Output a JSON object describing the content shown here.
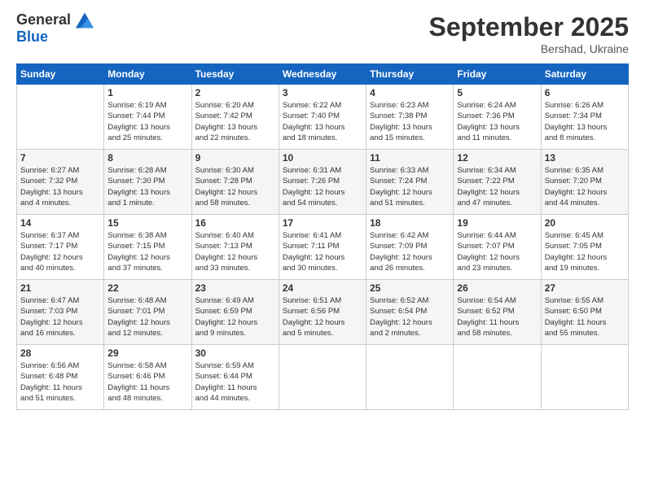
{
  "header": {
    "logo": {
      "general": "General",
      "blue": "Blue"
    },
    "title": "September 2025",
    "location": "Bershad, Ukraine"
  },
  "calendar": {
    "headers": [
      "Sunday",
      "Monday",
      "Tuesday",
      "Wednesday",
      "Thursday",
      "Friday",
      "Saturday"
    ],
    "weeks": [
      [
        {
          "day": "",
          "info": ""
        },
        {
          "day": "1",
          "info": "Sunrise: 6:19 AM\nSunset: 7:44 PM\nDaylight: 13 hours\nand 25 minutes."
        },
        {
          "day": "2",
          "info": "Sunrise: 6:20 AM\nSunset: 7:42 PM\nDaylight: 13 hours\nand 22 minutes."
        },
        {
          "day": "3",
          "info": "Sunrise: 6:22 AM\nSunset: 7:40 PM\nDaylight: 13 hours\nand 18 minutes."
        },
        {
          "day": "4",
          "info": "Sunrise: 6:23 AM\nSunset: 7:38 PM\nDaylight: 13 hours\nand 15 minutes."
        },
        {
          "day": "5",
          "info": "Sunrise: 6:24 AM\nSunset: 7:36 PM\nDaylight: 13 hours\nand 11 minutes."
        },
        {
          "day": "6",
          "info": "Sunrise: 6:26 AM\nSunset: 7:34 PM\nDaylight: 13 hours\nand 8 minutes."
        }
      ],
      [
        {
          "day": "7",
          "info": "Sunrise: 6:27 AM\nSunset: 7:32 PM\nDaylight: 13 hours\nand 4 minutes."
        },
        {
          "day": "8",
          "info": "Sunrise: 6:28 AM\nSunset: 7:30 PM\nDaylight: 13 hours\nand 1 minute."
        },
        {
          "day": "9",
          "info": "Sunrise: 6:30 AM\nSunset: 7:28 PM\nDaylight: 12 hours\nand 58 minutes."
        },
        {
          "day": "10",
          "info": "Sunrise: 6:31 AM\nSunset: 7:26 PM\nDaylight: 12 hours\nand 54 minutes."
        },
        {
          "day": "11",
          "info": "Sunrise: 6:33 AM\nSunset: 7:24 PM\nDaylight: 12 hours\nand 51 minutes."
        },
        {
          "day": "12",
          "info": "Sunrise: 6:34 AM\nSunset: 7:22 PM\nDaylight: 12 hours\nand 47 minutes."
        },
        {
          "day": "13",
          "info": "Sunrise: 6:35 AM\nSunset: 7:20 PM\nDaylight: 12 hours\nand 44 minutes."
        }
      ],
      [
        {
          "day": "14",
          "info": "Sunrise: 6:37 AM\nSunset: 7:17 PM\nDaylight: 12 hours\nand 40 minutes."
        },
        {
          "day": "15",
          "info": "Sunrise: 6:38 AM\nSunset: 7:15 PM\nDaylight: 12 hours\nand 37 minutes."
        },
        {
          "day": "16",
          "info": "Sunrise: 6:40 AM\nSunset: 7:13 PM\nDaylight: 12 hours\nand 33 minutes."
        },
        {
          "day": "17",
          "info": "Sunrise: 6:41 AM\nSunset: 7:11 PM\nDaylight: 12 hours\nand 30 minutes."
        },
        {
          "day": "18",
          "info": "Sunrise: 6:42 AM\nSunset: 7:09 PM\nDaylight: 12 hours\nand 26 minutes."
        },
        {
          "day": "19",
          "info": "Sunrise: 6:44 AM\nSunset: 7:07 PM\nDaylight: 12 hours\nand 23 minutes."
        },
        {
          "day": "20",
          "info": "Sunrise: 6:45 AM\nSunset: 7:05 PM\nDaylight: 12 hours\nand 19 minutes."
        }
      ],
      [
        {
          "day": "21",
          "info": "Sunrise: 6:47 AM\nSunset: 7:03 PM\nDaylight: 12 hours\nand 16 minutes."
        },
        {
          "day": "22",
          "info": "Sunrise: 6:48 AM\nSunset: 7:01 PM\nDaylight: 12 hours\nand 12 minutes."
        },
        {
          "day": "23",
          "info": "Sunrise: 6:49 AM\nSunset: 6:59 PM\nDaylight: 12 hours\nand 9 minutes."
        },
        {
          "day": "24",
          "info": "Sunrise: 6:51 AM\nSunset: 6:56 PM\nDaylight: 12 hours\nand 5 minutes."
        },
        {
          "day": "25",
          "info": "Sunrise: 6:52 AM\nSunset: 6:54 PM\nDaylight: 12 hours\nand 2 minutes."
        },
        {
          "day": "26",
          "info": "Sunrise: 6:54 AM\nSunset: 6:52 PM\nDaylight: 11 hours\nand 58 minutes."
        },
        {
          "day": "27",
          "info": "Sunrise: 6:55 AM\nSunset: 6:50 PM\nDaylight: 11 hours\nand 55 minutes."
        }
      ],
      [
        {
          "day": "28",
          "info": "Sunrise: 6:56 AM\nSunset: 6:48 PM\nDaylight: 11 hours\nand 51 minutes."
        },
        {
          "day": "29",
          "info": "Sunrise: 6:58 AM\nSunset: 6:46 PM\nDaylight: 11 hours\nand 48 minutes."
        },
        {
          "day": "30",
          "info": "Sunrise: 6:59 AM\nSunset: 6:44 PM\nDaylight: 11 hours\nand 44 minutes."
        },
        {
          "day": "",
          "info": ""
        },
        {
          "day": "",
          "info": ""
        },
        {
          "day": "",
          "info": ""
        },
        {
          "day": "",
          "info": ""
        }
      ]
    ]
  }
}
